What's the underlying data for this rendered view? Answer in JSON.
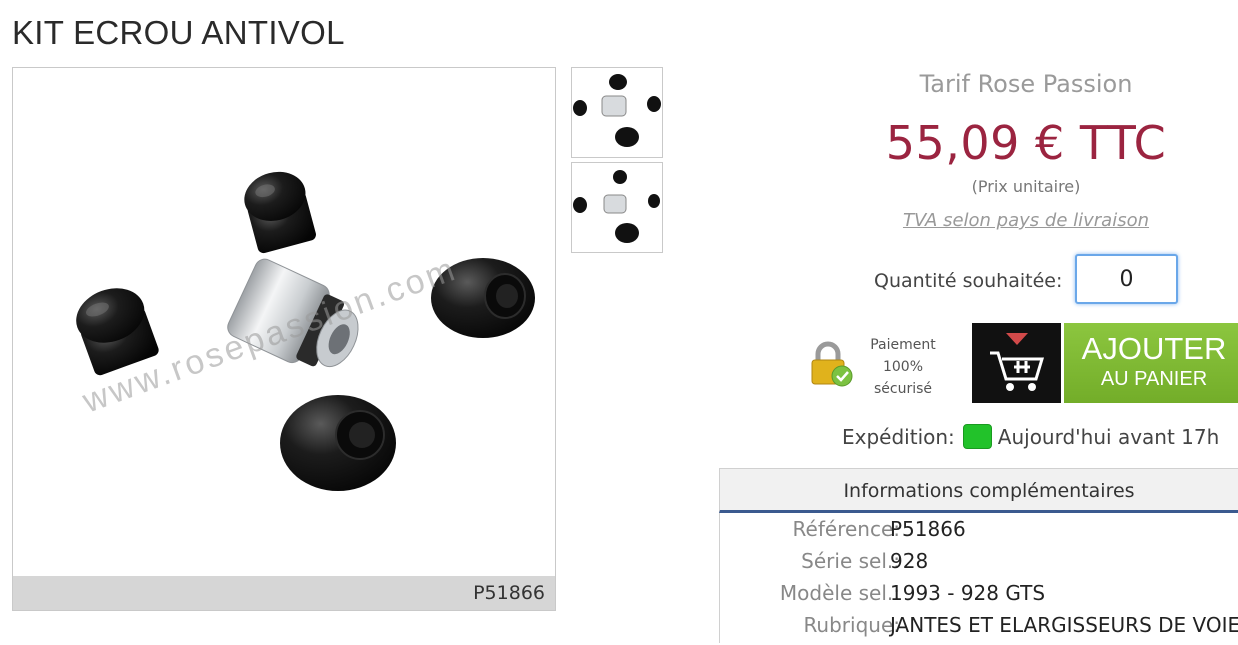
{
  "product": {
    "title": "KIT ECROU ANTIVOL",
    "reference_badge": "P51866"
  },
  "pricing": {
    "label": "Tarif Rose Passion",
    "price": "55,09 € TTC",
    "unit": "(Prix unitaire)",
    "tva_link": "TVA selon pays de livraison"
  },
  "quantity": {
    "label": "Quantité souhaitée:",
    "value": "0"
  },
  "payment": {
    "line1": "Paiement",
    "line2": "100%",
    "line3": "sécurisé"
  },
  "cart": {
    "add_line1": "AJOUTER",
    "add_line2": "AU PANIER"
  },
  "shipping": {
    "label": "Expédition:",
    "value": "Aujourd'hui avant 17h",
    "status_color": "#22c22a"
  },
  "info": {
    "header": "Informations complémentaires",
    "rows": [
      {
        "key": "Référence:",
        "value": "P51866"
      },
      {
        "key": "Série sel.:",
        "value": "928"
      },
      {
        "key": "Modèle sel.:",
        "value": "1993 - 928 GTS"
      },
      {
        "key": "Rubrique:",
        "value": "JANTES ET ELARGISSEURS DE VOIE E"
      }
    ]
  },
  "watermark": "www.rosepassion.com",
  "colors": {
    "price": "#9b2440",
    "add_button": "#8cc63f",
    "info_border": "#3b5a8f"
  }
}
